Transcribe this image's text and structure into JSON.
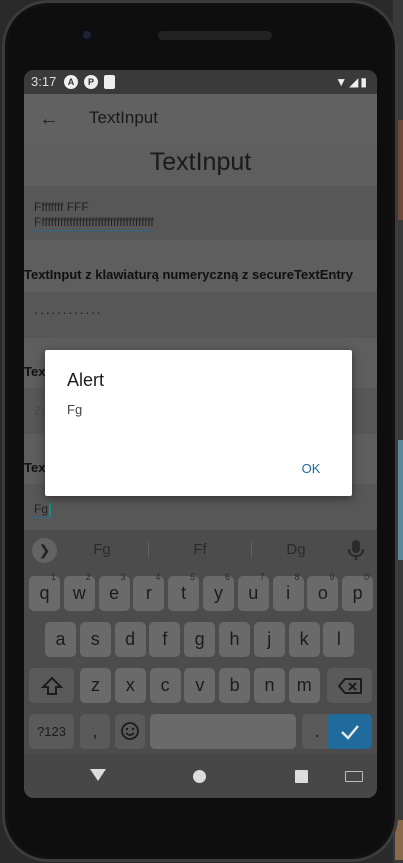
{
  "status_bar": {
    "time": "3:17",
    "icons": [
      "a-icon",
      "p-icon",
      "sd-card-icon"
    ],
    "right_icons": [
      "wifi-icon",
      "signal-icon",
      "battery-icon"
    ]
  },
  "app_bar": {
    "title": "TextInput"
  },
  "page": {
    "title": "TextInput",
    "field1": {
      "line1": "Ffffffff FFF",
      "line2": "Fffffffffffffffffffffffffffffffffffff"
    },
    "label_secure": "TextInput z klawiaturą numeryczną z secureTextEntry",
    "secure_value": "············",
    "label_third": "Text",
    "third_placeholder": "Za",
    "label_fourth": "Tex",
    "fourth_value": "Fg"
  },
  "keyboard": {
    "suggestions": [
      "Fg",
      "Ff",
      "Dg"
    ],
    "row1": [
      {
        "k": "q",
        "s": "1"
      },
      {
        "k": "w",
        "s": "2"
      },
      {
        "k": "e",
        "s": "3"
      },
      {
        "k": "r",
        "s": "4"
      },
      {
        "k": "t",
        "s": "5"
      },
      {
        "k": "y",
        "s": "6"
      },
      {
        "k": "u",
        "s": "7"
      },
      {
        "k": "i",
        "s": "8"
      },
      {
        "k": "o",
        "s": "9"
      },
      {
        "k": "p",
        "s": "0"
      }
    ],
    "row2": [
      "a",
      "s",
      "d",
      "f",
      "g",
      "h",
      "j",
      "k",
      "l"
    ],
    "row3": [
      "z",
      "x",
      "c",
      "v",
      "b",
      "n",
      "m"
    ],
    "symbols_label": "?123",
    "comma": ",",
    "period": "."
  },
  "dialog": {
    "title": "Alert",
    "message": "Fg",
    "ok_label": "OK"
  },
  "colors": {
    "accent": "#1e6b9c",
    "screen_dim": "#5e5e5e",
    "dialog_bg": "#ffffff"
  }
}
